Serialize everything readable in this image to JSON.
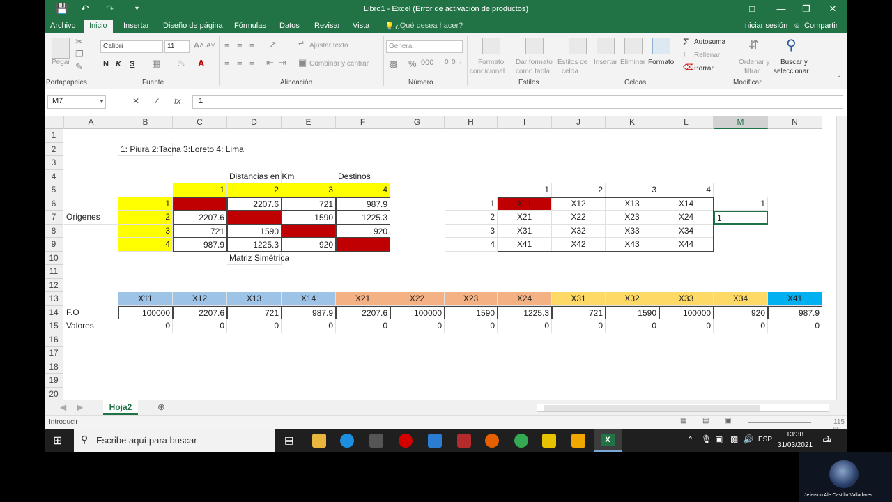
{
  "window": {
    "title": "Libro1 - Excel (Error de activación de productos)"
  },
  "ribbon_tabs": [
    "Archivo",
    "Inicio",
    "Insertar",
    "Diseño de página",
    "Fórmulas",
    "Datos",
    "Revisar",
    "Vista"
  ],
  "tell_me": "¿Qué desea hacer?",
  "account": {
    "signin": "Iniciar sesión",
    "share": "Compartir"
  },
  "ribbon": {
    "groups": [
      "Portapapeles",
      "Fuente",
      "Alineación",
      "Número",
      "Estilos",
      "Celdas",
      "Modificar"
    ],
    "paste": "Pegar",
    "font_name": "Calibri",
    "font_size": "11",
    "bold": "N",
    "italic": "K",
    "underline": "S",
    "wrap_text": "Ajustar texto",
    "merge_center": "Combinar y centrar",
    "number_format": "General",
    "cond_format": [
      "Formato",
      "condicional"
    ],
    "format_table": [
      "Dar formato",
      "como tabla"
    ],
    "cell_styles": [
      "Estilos de",
      "celda"
    ],
    "insert": "Insertar",
    "delete": "Eliminar",
    "format": "Formato",
    "autosum": "Autosuma",
    "fill": "Rellenar",
    "clear": "Borrar",
    "sort_filter": [
      "Ordenar y",
      "filtrar"
    ],
    "find_select": [
      "Buscar y",
      "seleccionar"
    ]
  },
  "formula_bar": {
    "name_box": "M7",
    "fx": "fx",
    "formula": "1"
  },
  "columns": [
    "A",
    "B",
    "C",
    "D",
    "E",
    "F",
    "G",
    "H",
    "I",
    "J",
    "K",
    "L",
    "M",
    "N"
  ],
  "selected_column": "M",
  "rows": [
    "1",
    "2",
    "3",
    "4",
    "5",
    "6",
    "7",
    "8",
    "9",
    "10",
    "11",
    "12",
    "13",
    "14",
    "15",
    "16",
    "17",
    "18",
    "19",
    "20"
  ],
  "sheet": {
    "legend": "1: Piura 2:Tacna 3:Loreto 4: Lima",
    "dist_title": "Distancias en Km",
    "destinos": "Destinos",
    "origenes": "Origenes",
    "matriz_sim": "Matriz Simétrica",
    "dest_headers": [
      "1",
      "2",
      "3",
      "4"
    ],
    "orig_headers": [
      "1",
      "2",
      "3",
      "4"
    ],
    "dist_matrix": [
      [
        "",
        "2207.6",
        "721",
        "987.9"
      ],
      [
        "2207.6",
        "",
        "1590",
        "1225.3"
      ],
      [
        "721",
        "1590",
        "",
        "920"
      ],
      [
        "987.9",
        "1225.3",
        "920",
        ""
      ]
    ],
    "var_col_headers": [
      "1",
      "2",
      "3",
      "4"
    ],
    "var_row_headers": [
      "1",
      "2",
      "3",
      "4"
    ],
    "var_matrix": [
      [
        "X11",
        "X12",
        "X13",
        "X14"
      ],
      [
        "X21",
        "X22",
        "X23",
        "X24"
      ],
      [
        "X31",
        "X32",
        "X33",
        "X34"
      ],
      [
        "X41",
        "X42",
        "X43",
        "X44"
      ]
    ],
    "m6": "1",
    "m7": "1",
    "row13_vars": [
      "X11",
      "X12",
      "X13",
      "X14",
      "X21",
      "X22",
      "X23",
      "X24",
      "X31",
      "X32",
      "X33",
      "X34",
      "X41"
    ],
    "fo_label": "F.O",
    "fo_values": [
      "100000",
      "2207.6",
      "721",
      "987.9",
      "2207.6",
      "100000",
      "1590",
      "1225.3",
      "721",
      "1590",
      "100000",
      "920",
      "987.9"
    ],
    "valores_label": "Valores",
    "valores": [
      "0",
      "0",
      "0",
      "0",
      "0",
      "0",
      "0",
      "0",
      "0",
      "0",
      "0",
      "0",
      "0"
    ]
  },
  "sheet_tab": "Hoja2",
  "status": {
    "mode": "Introducir",
    "zoom": "115 %"
  },
  "taskbar": {
    "search": "Escribe aquí para buscar",
    "lang": "ESP",
    "time": "13:38",
    "date": "31/03/2021",
    "notif": "1"
  },
  "webcam": {
    "name": "Jeferson Ale Castillo Valladares"
  },
  "colors": {
    "excel_green": "#217346",
    "yellow": "#ffff00",
    "red": "#c00000",
    "blue": "#9dc3e6",
    "orange": "#f4b183",
    "gold": "#ffd966",
    "cyan": "#00b0f0"
  }
}
